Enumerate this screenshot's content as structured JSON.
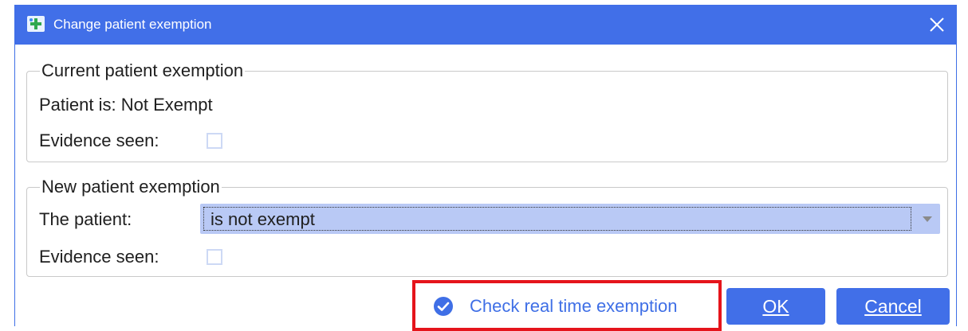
{
  "window": {
    "title": "Change patient exemption"
  },
  "current_group": {
    "legend": "Current patient exemption",
    "status_text": "Patient is: Not Exempt",
    "evidence_label": "Evidence seen:"
  },
  "new_group": {
    "legend": "New patient exemption",
    "patient_label": "The patient:",
    "patient_select_value": "is not exempt",
    "evidence_label": "Evidence seen:"
  },
  "actions": {
    "check_rt_label": "Check real time exemption",
    "ok_label": "OK",
    "cancel_label": "Cancel"
  },
  "colors": {
    "accent": "#416fe8",
    "highlight_border": "#e5141b",
    "select_bg": "#b9c9f5"
  },
  "icons": {
    "app": "app-icon",
    "close": "close-icon",
    "dropdown": "chevron-down-icon",
    "check": "check-circle-icon"
  }
}
